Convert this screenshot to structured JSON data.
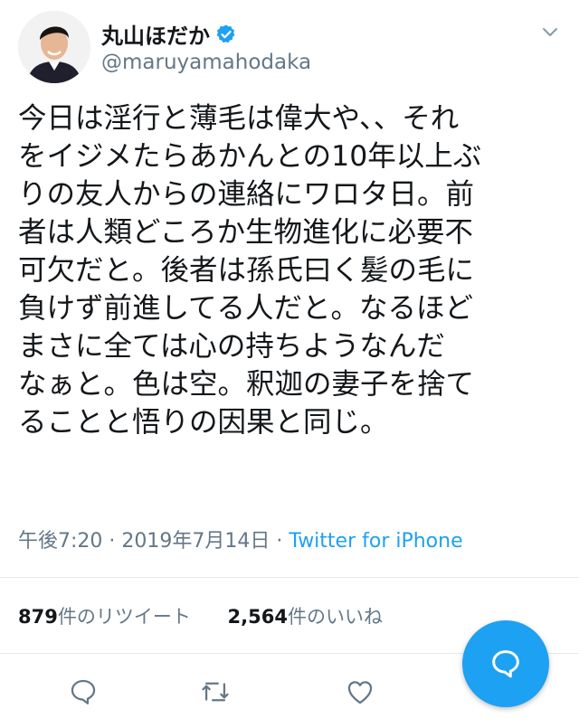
{
  "author": {
    "display_name": "丸山ほだか",
    "handle": "@maruyamahodaka",
    "verified": true
  },
  "tweet": {
    "lines": [
      "今日は淫行と薄毛は偉大や、、それ",
      "をイジメたらあかんとの10年以上ぶ",
      "りの友人からの連絡にワロタ日。前",
      "者は人類どころか生物進化に必要不",
      "可欠だと。後者は孫氏曰く髪の毛に",
      "負けず前進してる人だと。なるほど",
      "まさに全ては心の持ちようなんだ",
      "なぁと。色は空。釈迦の妻子を捨て",
      "ることと悟りの因果と同じ。"
    ],
    "time": "午後7:20",
    "date": "2019年7月14日",
    "separator": "·",
    "source": "Twitter for iPhone"
  },
  "stats": {
    "retweets_count": "879",
    "retweets_label": "件のリツイート",
    "likes_count": "2,564",
    "likes_label": "件のいいね"
  },
  "icons": {
    "verified": "verified-badge-icon",
    "menu": "chevron-down-icon",
    "reply": "reply-icon",
    "retweet": "retweet-icon",
    "like": "heart-icon",
    "compose": "compose-reply-icon"
  },
  "colors": {
    "accent": "#1da1f2",
    "text": "#14171a",
    "secondary": "#657786"
  }
}
